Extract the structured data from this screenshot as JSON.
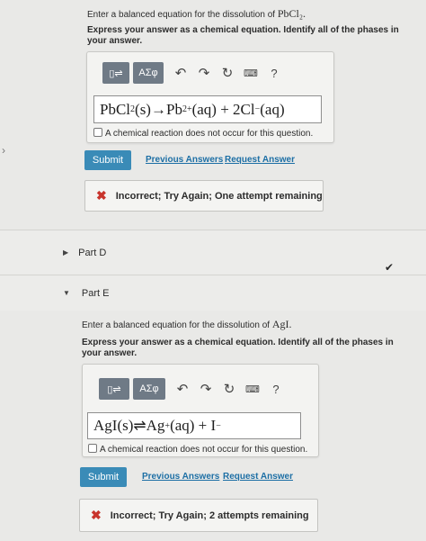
{
  "part_c": {
    "prompt_prefix": "Enter a balanced equation for the dissolution of",
    "prompt_formula": "PbCl₂.",
    "instruction": "Express your answer as a chemical equation. Identify all of the phases in your answer.",
    "toolbar": {
      "symbol_label": "ΑΣφ",
      "help_label": "?"
    },
    "answer": {
      "reactant": "PbCl",
      "reactant_sub": "2",
      "reactant_phase": " (s)",
      "arrow": "→",
      "cation": "Pb",
      "cation_charge": "2+",
      "cation_phase": " (aq) + 2Cl",
      "anion_charge": "−",
      "anion_phase": " (aq)"
    },
    "no_reaction_label": "A chemical reaction does not occur for this question.",
    "submit_label": "Submit",
    "previous_answers_label": "Previous Answers",
    "request_answer_label": "Request Answer",
    "feedback_text": "Incorrect; Try Again; One attempt remaining"
  },
  "part_d": {
    "label": "Part D"
  },
  "part_e": {
    "label": "Part E",
    "prompt_prefix": "Enter a balanced equation for the dissolution of",
    "prompt_formula": "AgI.",
    "instruction": "Express your answer as a chemical equation. Identify all of the phases in your answer.",
    "toolbar": {
      "symbol_label": "ΑΣφ",
      "help_label": "?"
    },
    "answer": {
      "reactant": "AgI(s)",
      "arrow": "⇌",
      "cation": "Ag",
      "cation_charge": "+",
      "cation_phase": "(aq) + I",
      "anion_charge": "−"
    },
    "no_reaction_label": "A chemical reaction does not occur for this question.",
    "submit_label": "Submit",
    "previous_answers_label": "Previous Answers",
    "request_answer_label": "Request Answer",
    "feedback_text": "Incorrect; Try Again; 2 attempts remaining"
  },
  "colors": {
    "accent": "#3a8bb7",
    "error": "#c8342c",
    "success": "#2a2a2a"
  }
}
